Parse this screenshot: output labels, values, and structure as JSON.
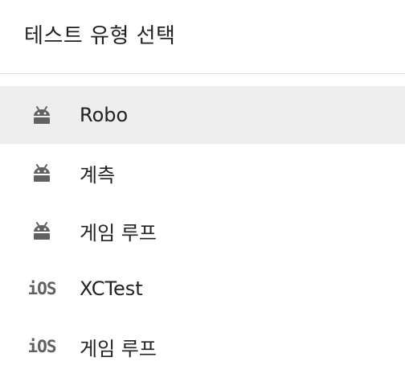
{
  "dialog": {
    "title": "테스트 유형 선택"
  },
  "items": [
    {
      "label": "Robo",
      "icon": "android-icon",
      "selected": true
    },
    {
      "label": "계측",
      "icon": "android-icon",
      "selected": false
    },
    {
      "label": "게임 루프",
      "icon": "android-icon",
      "selected": false
    },
    {
      "label": "XCTest",
      "icon": "ios-icon",
      "icon_text": "iOS",
      "selected": false
    },
    {
      "label": "게임 루프",
      "icon": "ios-icon",
      "icon_text": "iOS",
      "selected": false
    }
  ],
  "colors": {
    "selected_bg": "#eeeeee",
    "icon": "#616161",
    "text": "#212121",
    "divider": "#e0e0e0"
  }
}
